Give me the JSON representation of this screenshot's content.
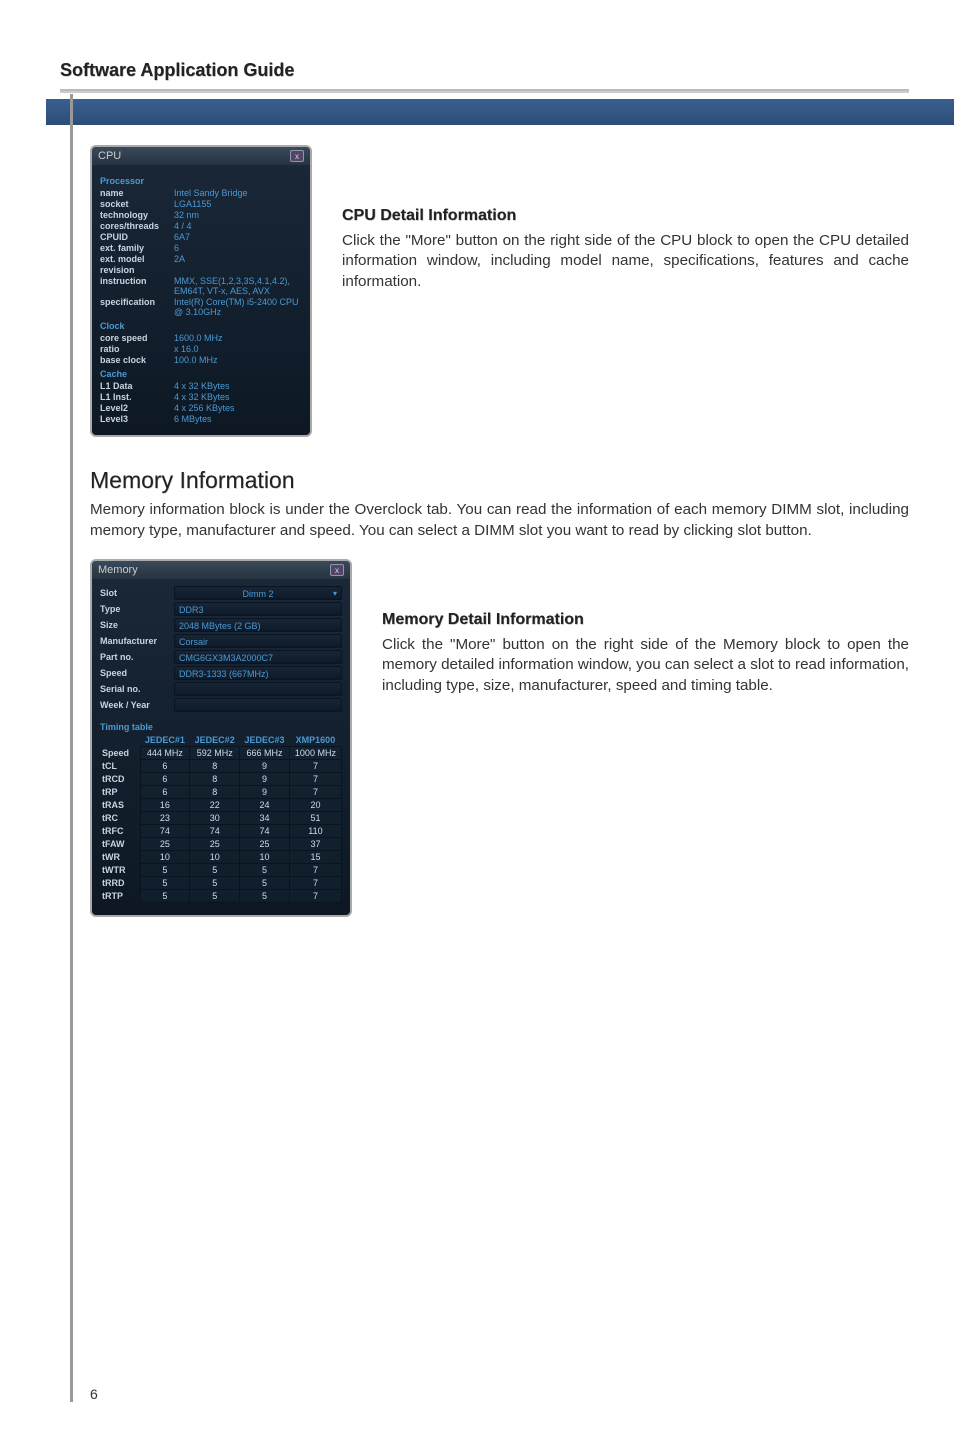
{
  "header": {
    "title": "Software Application Guide"
  },
  "cpu_panel": {
    "title": "CPU",
    "sections": {
      "processor": {
        "label": "Processor",
        "rows": [
          {
            "k": "name",
            "v": "Intel Sandy Bridge"
          },
          {
            "k": "socket",
            "v": "LGA1155"
          },
          {
            "k": "technology",
            "v": "32 nm"
          },
          {
            "k": "cores/threads",
            "v": "4 / 4"
          },
          {
            "k": "CPUID",
            "v": "6A7"
          },
          {
            "k": "ext. family",
            "v": "6"
          },
          {
            "k": "ext. model",
            "v": "2A"
          },
          {
            "k": "revision",
            "v": ""
          },
          {
            "k": "instruction",
            "v": "MMX, SSE(1,2,3,3S,4.1,4.2), EM64T, VT-x, AES, AVX"
          },
          {
            "k": "specification",
            "v": "Intel(R) Core(TM) i5-2400 CPU @ 3.10GHz"
          }
        ]
      },
      "clock": {
        "label": "Clock",
        "rows": [
          {
            "k": "core speed",
            "v": "1600.0 MHz"
          },
          {
            "k": "ratio",
            "v": "x 16.0"
          },
          {
            "k": "base clock",
            "v": "100.0 MHz"
          }
        ]
      },
      "cache": {
        "label": "Cache",
        "rows": [
          {
            "k": "L1 Data",
            "v": "4 x 32 KBytes"
          },
          {
            "k": "L1 Inst.",
            "v": "4 x 32 KBytes"
          },
          {
            "k": "Level2",
            "v": "4 x 256 KBytes"
          },
          {
            "k": "Level3",
            "v": "6 MBytes"
          }
        ]
      }
    }
  },
  "cpu_text": {
    "title": "CPU Detail Information",
    "body": "Click the \"More\" button on the right side of the CPU block to open the CPU detailed information window, including model name, specifications, features and cache information."
  },
  "memory_section": {
    "heading": "Memory Information",
    "desc": "Memory information block is under the Overclock tab. You can read the information of each memory DIMM slot, including memory type, manufacturer and speed. You can select a DIMM slot you want to read by clicking slot button."
  },
  "mem_panel": {
    "title": "Memory",
    "slot_label": "Slot",
    "slot_value": "Dimm 2",
    "rows": [
      {
        "k": "Type",
        "v": "DDR3"
      },
      {
        "k": "Size",
        "v": "2048 MBytes (2 GB)"
      },
      {
        "k": "Manufacturer",
        "v": "Corsair"
      },
      {
        "k": "Part no.",
        "v": "CMG6GX3M3A2000C7"
      },
      {
        "k": "Speed",
        "v": "DDR3-1333 (667MHz)"
      },
      {
        "k": "Serial no.",
        "v": ""
      },
      {
        "k": "Week / Year",
        "v": ""
      }
    ],
    "timing_label": "Timing table",
    "timing_headers": [
      "",
      "JEDEC#1",
      "JEDEC#2",
      "JEDEC#3",
      "XMP1600"
    ],
    "timing_rows": [
      {
        "label": "Speed",
        "c": [
          "444 MHz",
          "592 MHz",
          "666 MHz",
          "1000 MHz"
        ]
      },
      {
        "label": "tCL",
        "c": [
          "6",
          "8",
          "9",
          "7"
        ]
      },
      {
        "label": "tRCD",
        "c": [
          "6",
          "8",
          "9",
          "7"
        ]
      },
      {
        "label": "tRP",
        "c": [
          "6",
          "8",
          "9",
          "7"
        ]
      },
      {
        "label": "tRAS",
        "c": [
          "16",
          "22",
          "24",
          "20"
        ]
      },
      {
        "label": "tRC",
        "c": [
          "23",
          "30",
          "34",
          "51"
        ]
      },
      {
        "label": "tRFC",
        "c": [
          "74",
          "74",
          "74",
          "110"
        ]
      },
      {
        "label": "tFAW",
        "c": [
          "25",
          "25",
          "25",
          "37"
        ]
      },
      {
        "label": "tWR",
        "c": [
          "10",
          "10",
          "10",
          "15"
        ]
      },
      {
        "label": "tWTR",
        "c": [
          "5",
          "5",
          "5",
          "7"
        ]
      },
      {
        "label": "tRRD",
        "c": [
          "5",
          "5",
          "5",
          "7"
        ]
      },
      {
        "label": "tRTP",
        "c": [
          "5",
          "5",
          "5",
          "7"
        ]
      }
    ]
  },
  "mem_text": {
    "title": "Memory Detail Information",
    "body": "Click the \"More\" button on the right side of the Memory block to open the memory detailed information window, you can select a slot to read information, including type, size, manufacturer, speed and timing table."
  },
  "page_num": "6"
}
